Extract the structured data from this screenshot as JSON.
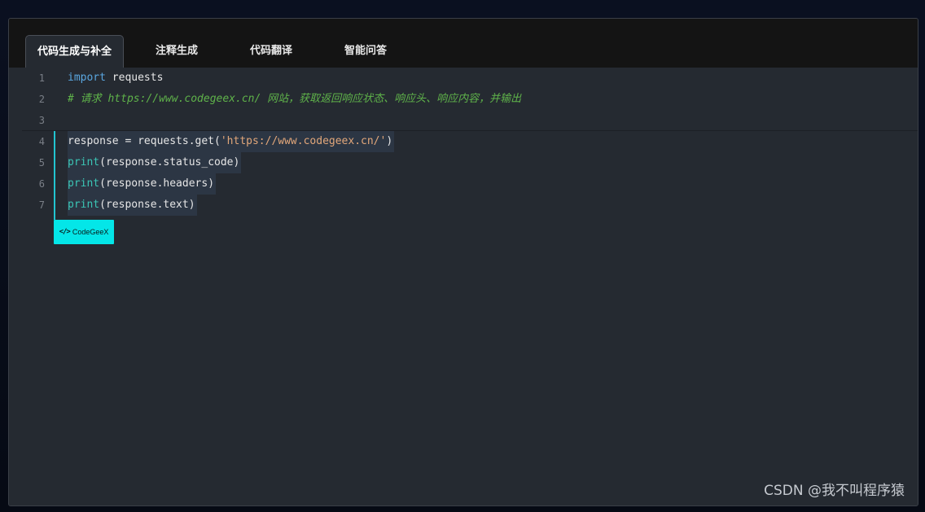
{
  "tabs": [
    {
      "label": "代码生成与补全",
      "active": true
    },
    {
      "label": "注释生成",
      "active": false
    },
    {
      "label": "代码翻译",
      "active": false
    },
    {
      "label": "智能问答",
      "active": false
    }
  ],
  "code": {
    "line_numbers": [
      "1",
      "2",
      "3",
      "4",
      "5",
      "6",
      "7"
    ],
    "line1": {
      "keyword": "import",
      "rest": " requests"
    },
    "line2": {
      "comment": "# 请求 https://www.codegeex.cn/ 网站，获取返回响应状态、响应头、响应内容，并输出"
    },
    "line4": {
      "prefix": "response = requests.get(",
      "string": "'https://www.codegeex.cn/'",
      "suffix": ")"
    },
    "line5": {
      "fn": "print",
      "rest": "(response.status_code)"
    },
    "line6": {
      "fn": "print",
      "rest": "(response.headers)"
    },
    "line7": {
      "fn": "print",
      "rest": "(response.text)"
    }
  },
  "badge": {
    "icon": "</>",
    "label": "CodeGeeX"
  },
  "watermark": "CSDN @我不叫程序猿",
  "colors": {
    "keyword": "#5aa7e0",
    "function": "#3bc5b5",
    "string": "#e2a77a",
    "comment": "#5fb34a",
    "accent": "#04e6e8"
  }
}
